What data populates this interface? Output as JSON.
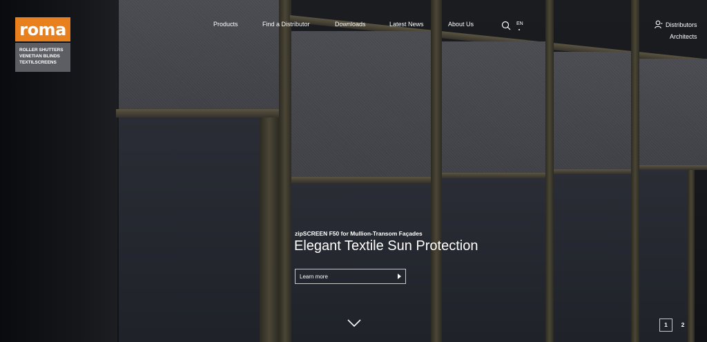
{
  "brand": {
    "logo": "roma",
    "tagline_lines": [
      "ROLLER SHUTTERS",
      "VENETIAN BLINDS",
      "TEXTILSCREENS"
    ]
  },
  "nav": {
    "items": [
      "Products",
      "Find a Distributor",
      "Downloads",
      "Latest News",
      "About Us"
    ],
    "language": "EN",
    "search_icon": "search-icon",
    "user_icon": "user-icon"
  },
  "audience_links": [
    "Distributors",
    "Architects"
  ],
  "hero": {
    "subtitle": "zipSCREEN F50 for Mullion-Transom Façades",
    "title": "Elegant Textile Sun Protection",
    "cta_label": "Learn more",
    "scroll_icon": "chevron-down-icon"
  },
  "pagination": {
    "pages": [
      "1",
      "2"
    ],
    "active": "1"
  },
  "colors": {
    "brand_orange": "#e8801e",
    "tagline_bg": "#5d5e63",
    "background": "#15171b"
  }
}
